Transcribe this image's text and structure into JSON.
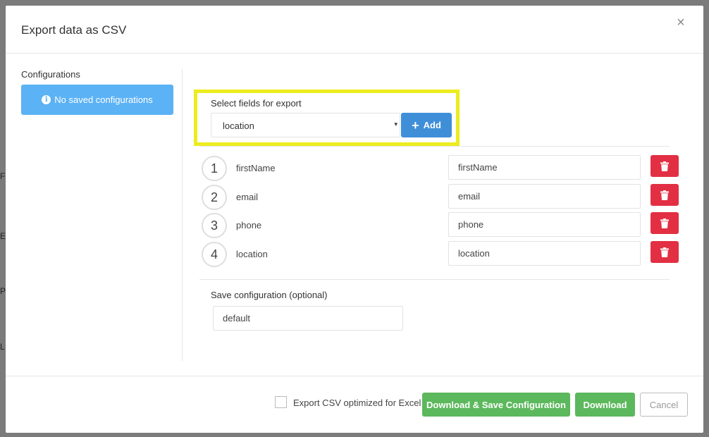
{
  "modal": {
    "title": "Export data as CSV",
    "close_icon": "close-icon",
    "close_glyph": "×"
  },
  "sidebar": {
    "title": "Configurations",
    "info_text": "No saved configurations",
    "info_glyph": "i"
  },
  "select_fields": {
    "label": "Select fields for export",
    "selected": "location",
    "add_label": "Add",
    "add_glyph": "+",
    "caret_glyph": "▾"
  },
  "fields": [
    {
      "num": "1",
      "name": "firstName",
      "value": "firstName"
    },
    {
      "num": "2",
      "name": "email",
      "value": "email"
    },
    {
      "num": "3",
      "name": "phone",
      "value": "phone"
    },
    {
      "num": "4",
      "name": "location",
      "value": "location"
    }
  ],
  "save_config": {
    "label": "Save configuration (optional)",
    "value": "default"
  },
  "footer": {
    "excel_label": "Export CSV optimized for Excel",
    "download_save_label": "Download & Save Configuration",
    "download_label": "Download",
    "cancel_label": "Cancel"
  },
  "colors": {
    "info": "#5bb2f5",
    "primary": "#3f8fd8",
    "danger": "#e22f43",
    "success": "#5cb85c",
    "highlight": "#ecec1f"
  }
}
